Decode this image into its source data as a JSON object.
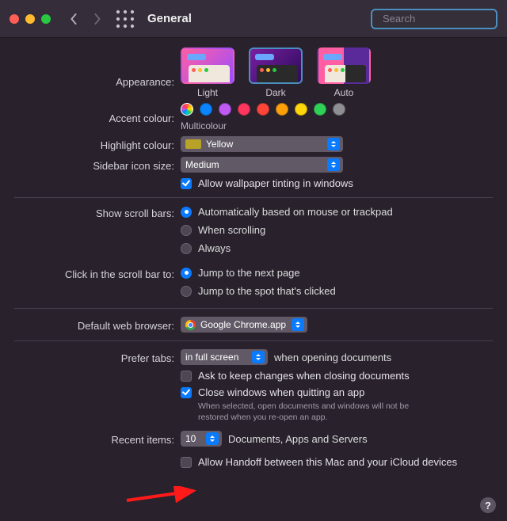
{
  "toolbar": {
    "title": "General",
    "search_placeholder": "Search"
  },
  "appearance": {
    "label": "Appearance:",
    "options": [
      "Light",
      "Dark",
      "Auto"
    ],
    "selected": "Dark"
  },
  "accent": {
    "label": "Accent colour:",
    "caption": "Multicolour",
    "colors": [
      "multi",
      "#0a84ff",
      "#bf5af2",
      "#ff375f",
      "#ff453a",
      "#ff9f0a",
      "#ffd60a",
      "#30d158",
      "#8e8e93"
    ]
  },
  "highlight": {
    "label": "Highlight colour:",
    "value": "Yellow"
  },
  "sidebar_size": {
    "label": "Sidebar icon size:",
    "value": "Medium"
  },
  "wallpaper_tint": {
    "checked": true,
    "text": "Allow wallpaper tinting in windows"
  },
  "scroll_bars": {
    "label": "Show scroll bars:",
    "options": [
      "Automatically based on mouse or trackpad",
      "When scrolling",
      "Always"
    ],
    "selected_index": 0
  },
  "scroll_click": {
    "label": "Click in the scroll bar to:",
    "options": [
      "Jump to the next page",
      "Jump to the spot that's clicked"
    ],
    "selected_index": 0
  },
  "default_browser": {
    "label": "Default web browser:",
    "value": "Google Chrome.app"
  },
  "prefer_tabs": {
    "label": "Prefer tabs:",
    "value": "in full screen",
    "suffix": "when opening documents"
  },
  "ask_keep_changes": {
    "checked": false,
    "text": "Ask to keep changes when closing documents"
  },
  "close_windows": {
    "checked": true,
    "text": "Close windows when quitting an app",
    "note": "When selected, open documents and windows will not be restored when you re-open an app."
  },
  "recent_items": {
    "label": "Recent items:",
    "value": "10",
    "suffix": "Documents, Apps and Servers"
  },
  "handoff": {
    "checked": false,
    "text": "Allow Handoff between this Mac and your iCloud devices"
  },
  "help_glyph": "?"
}
